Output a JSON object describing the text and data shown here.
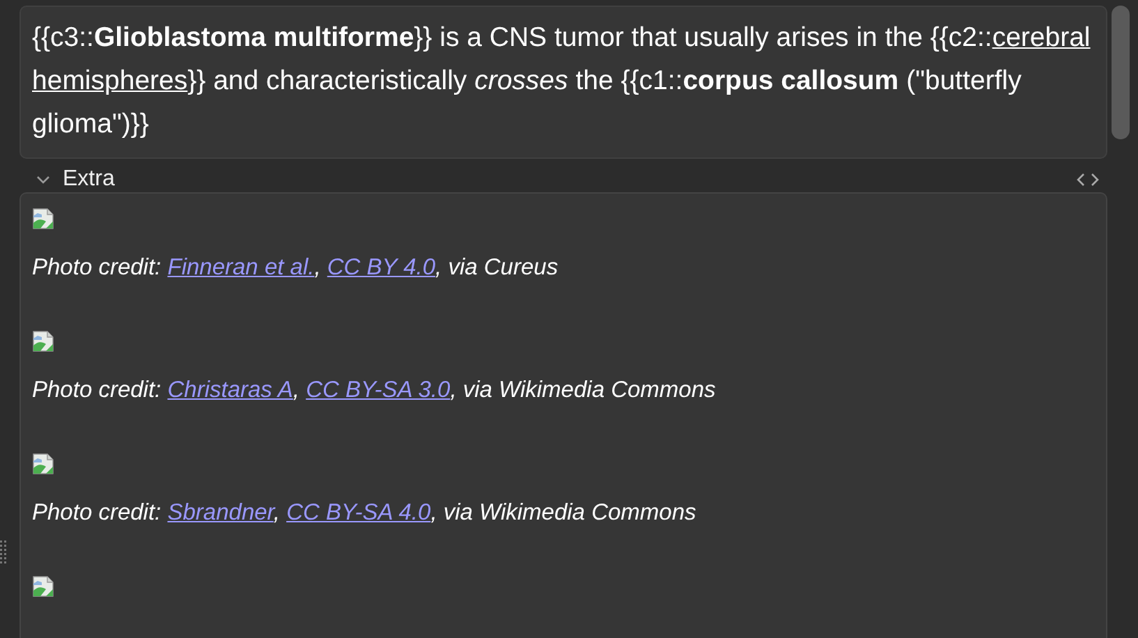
{
  "front_field": {
    "segments": [
      {
        "kind": "plain",
        "text": "{{c3::"
      },
      {
        "kind": "bold",
        "text": "Glioblastoma multiforme"
      },
      {
        "kind": "plain",
        "text": "}} is a CNS tumor that usually arises in the {{c2::"
      },
      {
        "kind": "underline",
        "text": "cerebral hemispheres"
      },
      {
        "kind": "plain",
        "text": "}} and characteristically "
      },
      {
        "kind": "italic",
        "text": "crosses"
      },
      {
        "kind": "plain",
        "text": " the {{c1::"
      },
      {
        "kind": "bold",
        "text": "corpus callosum"
      },
      {
        "kind": "plain",
        "text": " (\"butterfly glioma\")}}"
      }
    ]
  },
  "extra_field": {
    "label": "Extra",
    "expanded": true,
    "items": [
      {
        "kind": "broken_image",
        "credit": [
          {
            "kind": "text",
            "text": "Photo credit: "
          },
          {
            "kind": "link",
            "text": "Finneran et al."
          },
          {
            "kind": "text",
            "text": ", "
          },
          {
            "kind": "link",
            "text": "CC BY 4.0"
          },
          {
            "kind": "text",
            "text": ", via Cureus"
          }
        ]
      },
      {
        "kind": "broken_image",
        "credit": [
          {
            "kind": "text",
            "text": "Photo credit: "
          },
          {
            "kind": "link",
            "text": "Christaras A"
          },
          {
            "kind": "text",
            "text": ", "
          },
          {
            "kind": "link",
            "text": "CC BY-SA 3.0"
          },
          {
            "kind": "text",
            "text": ", via Wikimedia Commons"
          }
        ]
      },
      {
        "kind": "broken_image",
        "credit": [
          {
            "kind": "text",
            "text": "Photo credit: "
          },
          {
            "kind": "link",
            "text": "Sbrandner"
          },
          {
            "kind": "text",
            "text": ", "
          },
          {
            "kind": "link",
            "text": "CC BY-SA 4.0"
          },
          {
            "kind": "text",
            "text": ", via Wikimedia Commons"
          }
        ]
      },
      {
        "kind": "broken_image"
      }
    ]
  }
}
